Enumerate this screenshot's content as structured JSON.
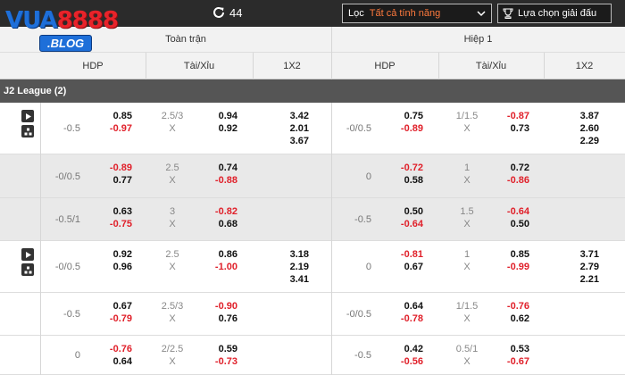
{
  "logo": {
    "part1": "VUA",
    "part2": "8888",
    "blog": ".BLOG"
  },
  "topbar": {
    "refresh_count": "44",
    "filter_label": "Lọc",
    "filter_value": "Tất cả tính năng",
    "league_select": "Lựa chọn giải đấu"
  },
  "header": {
    "full_match": "Toàn trận",
    "half": "Hiệp 1",
    "cols": [
      "HDP",
      "Tài/Xỉu",
      "1X2",
      "HDP",
      "Tài/Xỉu",
      "1X2"
    ]
  },
  "league": "J2 League (2)",
  "rows": [
    {
      "hdp_line": "-0.5",
      "hdp_a": "0.85",
      "hdp_b": "-0.97",
      "ou_line": "2.5/3",
      "ou_x": "X",
      "ou_a": "0.94",
      "ou_b": "0.92",
      "x12": [
        "3.42",
        "2.01",
        "3.67"
      ],
      "h_hdp_line": "-0/0.5",
      "h_hdp_a": "0.75",
      "h_hdp_b": "-0.89",
      "h_ou_line": "1/1.5",
      "h_ou_x": "X",
      "h_ou_a": "-0.87",
      "h_ou_b": "0.73",
      "h_x12": [
        "3.87",
        "2.60",
        "2.29"
      ]
    },
    {
      "hdp_line": "-0/0.5",
      "hdp_a": "-0.89",
      "hdp_b": "0.77",
      "ou_line": "2.5",
      "ou_x": "X",
      "ou_a": "0.74",
      "ou_b": "-0.88",
      "x12": [
        "",
        "",
        ""
      ],
      "h_hdp_line": "0",
      "h_hdp_a": "-0.72",
      "h_hdp_b": "0.58",
      "h_ou_line": "1",
      "h_ou_x": "X",
      "h_ou_a": "0.72",
      "h_ou_b": "-0.86",
      "h_x12": [
        "",
        "",
        ""
      ]
    },
    {
      "hdp_line": "-0.5/1",
      "hdp_a": "0.63",
      "hdp_b": "-0.75",
      "ou_line": "3",
      "ou_x": "X",
      "ou_a": "-0.82",
      "ou_b": "0.68",
      "x12": [
        "",
        "",
        ""
      ],
      "h_hdp_line": "-0.5",
      "h_hdp_a": "0.50",
      "h_hdp_b": "-0.64",
      "h_ou_line": "1.5",
      "h_ou_x": "X",
      "h_ou_a": "-0.64",
      "h_ou_b": "0.50",
      "h_x12": [
        "",
        "",
        ""
      ]
    },
    {
      "hdp_line": "-0/0.5",
      "hdp_a": "0.92",
      "hdp_b": "0.96",
      "ou_line": "2.5",
      "ou_x": "X",
      "ou_a": "0.86",
      "ou_b": "-1.00",
      "x12": [
        "3.18",
        "2.19",
        "3.41"
      ],
      "h_hdp_line": "0",
      "h_hdp_a": "-0.81",
      "h_hdp_b": "0.67",
      "h_ou_line": "1",
      "h_ou_x": "X",
      "h_ou_a": "0.85",
      "h_ou_b": "-0.99",
      "h_x12": [
        "3.71",
        "2.79",
        "2.21"
      ]
    },
    {
      "hdp_line": "-0.5",
      "hdp_a": "0.67",
      "hdp_b": "-0.79",
      "ou_line": "2.5/3",
      "ou_x": "X",
      "ou_a": "-0.90",
      "ou_b": "0.76",
      "x12": [
        "",
        "",
        ""
      ],
      "h_hdp_line": "-0/0.5",
      "h_hdp_a": "0.64",
      "h_hdp_b": "-0.78",
      "h_ou_line": "1/1.5",
      "h_ou_x": "X",
      "h_ou_a": "-0.76",
      "h_ou_b": "0.62",
      "h_x12": [
        "",
        "",
        ""
      ]
    },
    {
      "hdp_line": "0",
      "hdp_a": "-0.76",
      "hdp_b": "0.64",
      "ou_line": "2/2.5",
      "ou_x": "X",
      "ou_a": "0.59",
      "ou_b": "-0.73",
      "x12": [
        "",
        "",
        ""
      ],
      "h_hdp_line": "-0.5",
      "h_hdp_a": "0.42",
      "h_hdp_b": "-0.56",
      "h_ou_line": "0.5/1",
      "h_ou_x": "X",
      "h_ou_a": "0.53",
      "h_ou_b": "-0.67",
      "h_x12": [
        "",
        "",
        ""
      ]
    }
  ],
  "colors": {
    "negative": "#e0202a",
    "positive": "#111111",
    "topbar": "#2b2b2b",
    "league_bar": "#555555"
  }
}
